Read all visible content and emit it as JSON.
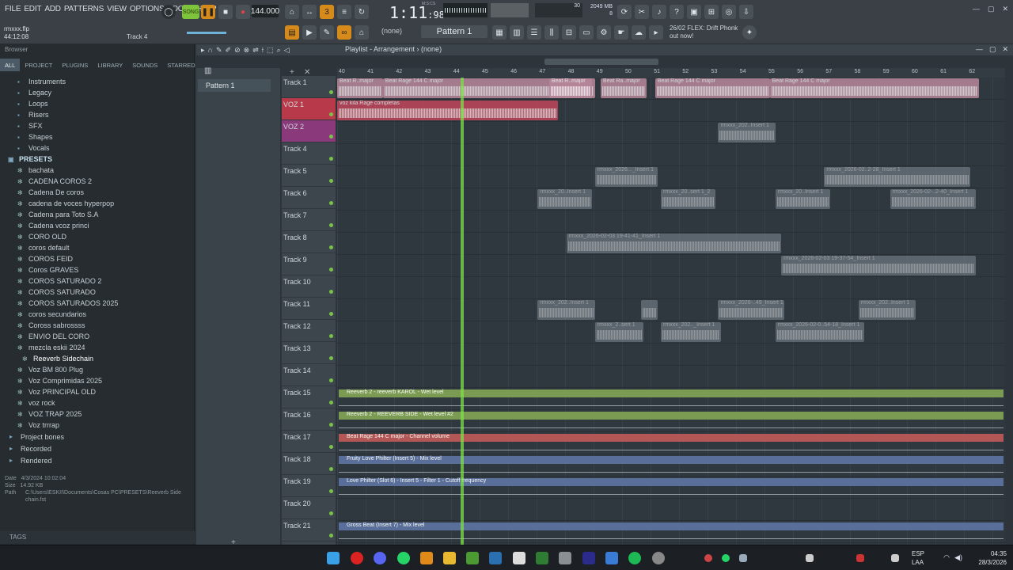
{
  "menu": [
    "FILE",
    "EDIT",
    "ADD",
    "PATTERNS",
    "VIEW",
    "OPTIONS",
    "TOOLS",
    "HELP"
  ],
  "transport": {
    "mode": "SONG",
    "tempo": "144.000",
    "time_main": "1:11",
    "time_ms": "98",
    "time_unit": "M:S:CS",
    "cpu": "30",
    "mem": "2049 MB",
    "mem_poly": "8"
  },
  "pattern_select": "Pattern 1",
  "none_label": "(none)",
  "hint": "26/02 FLEX: Drift Phonk out now!",
  "project": {
    "file": "rmxxx.flp",
    "time": "44:12:08",
    "focused_track": "Track 4"
  },
  "browser": {
    "title": "Browser",
    "tabs": [
      "ALL",
      "PROJECT",
      "PLUGINS",
      "LIBRARY",
      "SOUNDS",
      "STARRED"
    ],
    "folders": [
      "Instruments",
      "Legacy",
      "Loops",
      "Risers",
      "SFX",
      "Shapes",
      "Vocals"
    ],
    "presets_header": "PRESETS",
    "presets": [
      "bachata",
      "CADENA COROS 2",
      "Cadena De coros",
      "cadena de voces hyperpop",
      "Cadena para Toto S.A",
      "Cadena vcoz princi",
      "CORO OLD",
      "coros default",
      "COROS FEID",
      "Coros GRAVES",
      "COROS SATURADO 2",
      "COROS SATURADO",
      "COROS SATURADOS 2025",
      "coros secundarios",
      "Coross sabrossss",
      "ENVIO DEL CORO",
      "mezcla eskii 2024",
      "Reeverb Sidechain",
      "Voz BM 800 Plug",
      "Voz Comprimidas 2025",
      "Voz PRINCIPAL OLD",
      "voz rock",
      "VOZ TRAP 2025",
      "Voz trrrap"
    ],
    "selected_preset": "Reeverb Sidechain",
    "bottom": [
      "Project bones",
      "Recorded",
      "Rendered"
    ],
    "info": {
      "date_label": "Date",
      "date": "4/3/2024 10:02:04",
      "size_label": "Size",
      "size": "14.92 KB",
      "path_label": "Path",
      "path": "C:\\Users\\ESKII\\Documents\\Cosas PC\\PRESETS\\Reeverb Sidechain.fst"
    },
    "tags": "TAGS"
  },
  "playlist": {
    "title": "Playlist - Arrangement",
    "arrangement": "(none)",
    "pattern": "Pattern 1",
    "ruler": [
      "40",
      "41",
      "42",
      "43",
      "44",
      "45",
      "46",
      "47",
      "48",
      "49",
      "50",
      "51",
      "52",
      "53",
      "54",
      "55",
      "56",
      "57",
      "58",
      "59",
      "60",
      "61",
      "62"
    ],
    "tracks": [
      "Track 1",
      "VOZ 1",
      "VOZ 2",
      "Track 4",
      "Track 5",
      "Track 6",
      "Track 7",
      "Track 8",
      "Track 9",
      "Track 10",
      "Track 11",
      "Track 12",
      "Track 13",
      "Track 14",
      "Track 15",
      "Track 16",
      "Track 17",
      "Track 18",
      "Track 19",
      "Track 20",
      "Track 21"
    ],
    "clips": [
      {
        "track": 0,
        "start": 40,
        "len": 1.6,
        "label": "Beat R..major",
        "color": "#b8879a"
      },
      {
        "track": 0,
        "start": 41.6,
        "len": 7.4,
        "label": "Beat Rage 144 C major",
        "color": "#b8879a"
      },
      {
        "track": 0,
        "start": 47.4,
        "len": 1.5,
        "label": "Beat R..major",
        "color": "#b8879a"
      },
      {
        "track": 0,
        "start": 49.2,
        "len": 1.6,
        "label": "Beat Ra..major",
        "color": "#b8879a"
      },
      {
        "track": 0,
        "start": 51.1,
        "len": 4.0,
        "label": "Beat Rage 144 C major",
        "color": "#b8879a"
      },
      {
        "track": 0,
        "start": 55.1,
        "len": 7.3,
        "label": "Beat Rage 144 C major",
        "color": "#b8879a"
      },
      {
        "track": 1,
        "start": 40,
        "len": 7.7,
        "label": "voz kila Rage completas",
        "color": "#c0465a"
      },
      {
        "track": 2,
        "start": 53.3,
        "len": 2.0,
        "label": "rmxxx_202..Insert 1",
        "color": "#808a96"
      },
      {
        "track": 4,
        "start": 49.0,
        "len": 2.2,
        "label": "rmxxx_2026..._Insert 1",
        "color": "#808a96"
      },
      {
        "track": 4,
        "start": 57.0,
        "len": 5.1,
        "label": "rmxxx_2026-02..2-28_Insert 1",
        "color": "#808a96"
      },
      {
        "track": 5,
        "start": 47.0,
        "len": 1.9,
        "label": "rmxxx_20..Insert 1",
        "color": "#808a96"
      },
      {
        "track": 5,
        "start": 51.3,
        "len": 1.9,
        "label": "rmxxx_20..sert 1_2",
        "color": "#808a96"
      },
      {
        "track": 5,
        "start": 55.3,
        "len": 1.9,
        "label": "rmxxx_20..Insert 1",
        "color": "#808a96"
      },
      {
        "track": 5,
        "start": 59.3,
        "len": 3.0,
        "label": "rmxxx_2026-02-..2-40_Insert 1",
        "color": "#808a96"
      },
      {
        "track": 7,
        "start": 48.0,
        "len": 7.5,
        "label": "rmxxx_2026-02-03 19-41-41_Insert 1",
        "color": "#808a96"
      },
      {
        "track": 8,
        "start": 55.5,
        "len": 6.8,
        "label": "rmxxx_2026-02-03 19-37-54_Insert 1",
        "color": "#808a96"
      },
      {
        "track": 10,
        "start": 47.0,
        "len": 2.0,
        "label": "rmxxx_202..Insert 1",
        "color": "#808a96"
      },
      {
        "track": 10,
        "start": 50.6,
        "len": 0.6,
        "label": "",
        "color": "#808a96"
      },
      {
        "track": 10,
        "start": 53.3,
        "len": 2.3,
        "label": "rmxxx_2026-..49_Insert 1",
        "color": "#808a96"
      },
      {
        "track": 10,
        "start": 58.2,
        "len": 2.0,
        "label": "rmxxx_202..Insert 1",
        "color": "#808a96"
      },
      {
        "track": 11,
        "start": 49.0,
        "len": 1.7,
        "label": "rmxxx_2..sert 1",
        "color": "#808a96"
      },
      {
        "track": 11,
        "start": 51.3,
        "len": 2.1,
        "label": "rmxxx_202.._Insert 1",
        "color": "#808a96"
      },
      {
        "track": 11,
        "start": 55.3,
        "len": 3.1,
        "label": "rmxxx_2026-02-0..54-18_Insert 1",
        "color": "#808a96"
      }
    ],
    "automation": [
      {
        "track": 14,
        "label": "Reeverb 2 - reeverb KAROL - Wet level",
        "color": "#7b9a52"
      },
      {
        "track": 15,
        "label": "Reeverb 2 - REEVERB SIDE - Wet level #2",
        "color": "#7b9a52"
      },
      {
        "track": 16,
        "label": "Beat Rage 144 C major - Channel volume",
        "color": "#b25656"
      },
      {
        "track": 17,
        "label": "Fruity Love Philter (Insert 5) - Mix level",
        "color": "#5a6e9a"
      },
      {
        "track": 18,
        "label": "Love Philter (Slot 6) - Insert 5 - Filter 1 - Cutoff frequency",
        "color": "#5a6e9a"
      },
      {
        "track": 20,
        "label": "Gross Beat (Insert 7) - Mix level",
        "color": "#5a6e9a"
      }
    ],
    "playhead_bar": 44.3
  },
  "taskbar": {
    "lang_top": "ESP",
    "lang_bottom": "LAA",
    "time": "04:35",
    "date": "28/3/2026"
  }
}
